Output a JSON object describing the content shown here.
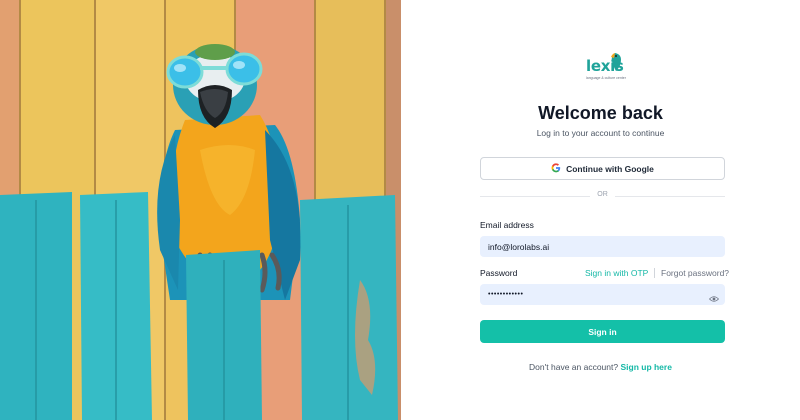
{
  "brand": {
    "name": "lexis",
    "tagline": "language & culture center"
  },
  "header": {
    "title": "Welcome back",
    "subtitle": "Log in to your account to continue"
  },
  "oauth": {
    "google_label": "Continue with Google"
  },
  "divider": {
    "text": "OR"
  },
  "form": {
    "email_label": "Email address",
    "email_value": "info@lorolabs.ai",
    "password_label": "Password",
    "password_value": "••••••••••••",
    "otp_link": "Sign in with OTP",
    "forgot_link": "Forgot password?",
    "submit_label": "Sign in"
  },
  "footer": {
    "prompt": "Don't have an account?",
    "signup_link": "Sign up here"
  },
  "colors": {
    "accent": "#14c0a8",
    "field_bg": "#e8f0fe"
  },
  "icons": {
    "google": "google-icon",
    "eye": "eye-icon",
    "logo_bird": "parrot-icon"
  }
}
